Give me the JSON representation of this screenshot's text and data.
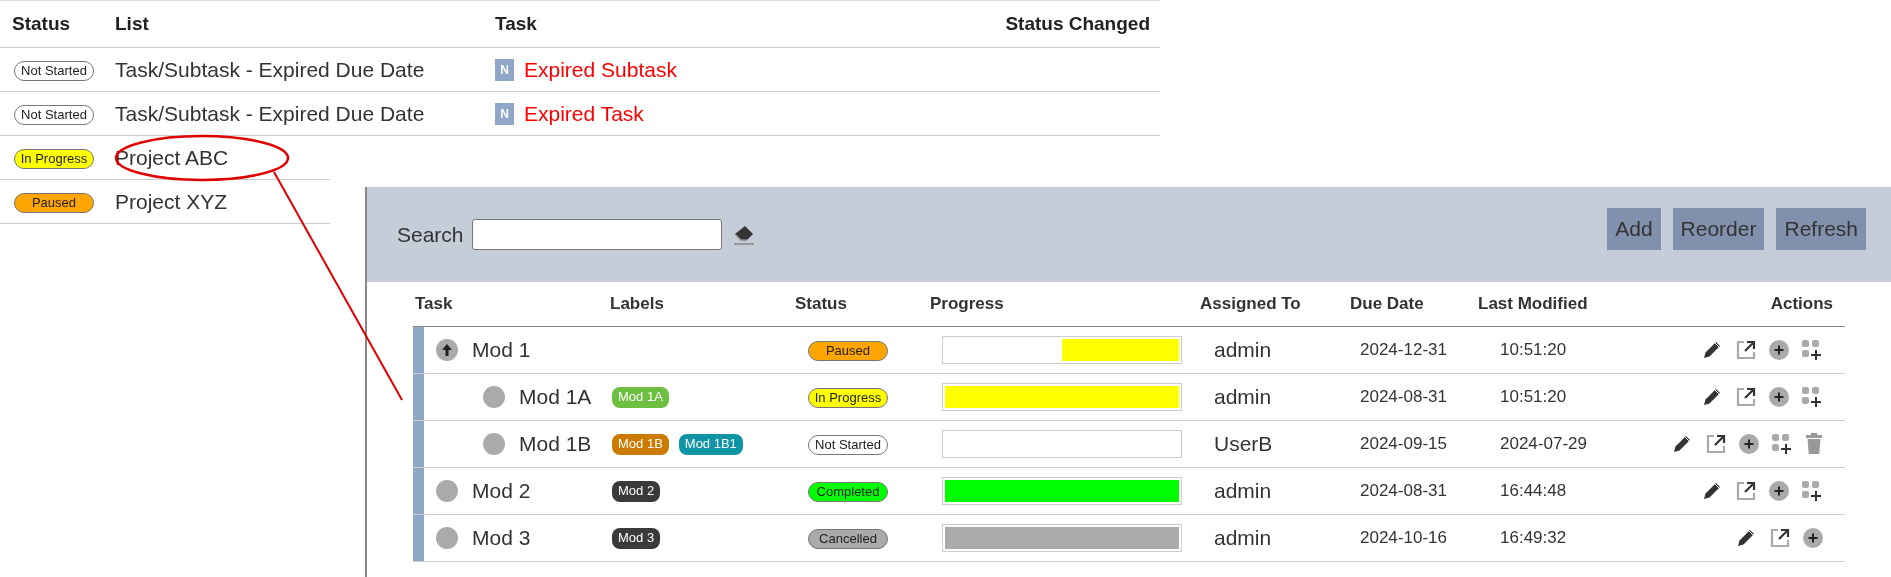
{
  "background_table": {
    "columns": [
      "Status",
      "List",
      "Task",
      "Status Changed"
    ],
    "rows": [
      {
        "status": {
          "text": "Not Started",
          "color": "#ffffff"
        },
        "list": "Task/Subtask - Expired Due Date",
        "task_badge": "N",
        "task": "Expired Subtask",
        "task_expired": true
      },
      {
        "status": {
          "text": "Not Started",
          "color": "#ffffff"
        },
        "list": "Task/Subtask - Expired Due Date",
        "task_badge": "N",
        "task": "Expired Task",
        "task_expired": true
      },
      {
        "status": {
          "text": "In Progress",
          "color": "#ffff00"
        },
        "list": "Project ABC"
      },
      {
        "status": {
          "text": "Paused",
          "color": "#ffa500"
        },
        "list": "Project XYZ"
      }
    ]
  },
  "panel": {
    "search": {
      "label": "Search"
    },
    "buttons": [
      "Add",
      "Reorder",
      "Refresh"
    ],
    "table": {
      "columns": [
        "Task",
        "Labels",
        "Status",
        "Progress",
        "Assigned To",
        "Due Date",
        "Last Modified",
        "Actions"
      ],
      "rows": [
        {
          "task": "Mod 1",
          "kind": "parent",
          "labels": [],
          "status": {
            "text": "Paused",
            "color": "#ffa500"
          },
          "progress": {
            "level": 0.5,
            "color": "#ffff00"
          },
          "assigned_to": "admin",
          "due_date": "2024-12-31",
          "last_modified": "10:51:20",
          "can_add_subtask": true,
          "can_delete": false,
          "children": [
            {
              "task": "Mod 1A",
              "kind": "leaf",
              "labels": [
                {
                  "text": "Mod 1A",
                  "color": "#6cbf3f"
                }
              ],
              "status": {
                "text": "In Progress",
                "color": "#ffff00"
              },
              "progress": {
                "level": 1,
                "color": "#ffff00"
              },
              "assigned_to": "admin",
              "due_date": "2024-08-31",
              "last_modified": "10:51:20",
              "can_add_subtask": true,
              "can_delete": false
            },
            {
              "task": "Mod 1B",
              "kind": "leaf",
              "labels": [
                {
                  "text": "Mod 1B",
                  "color": "#cc7a00"
                },
                {
                  "text": "Mod 1B1",
                  "color": "#0f94a6"
                }
              ],
              "status": {
                "text": "Not Started",
                "color": "#ffffff"
              },
              "progress": {
                "level": 0,
                "color": "#ffffff"
              },
              "assigned_to": "UserB",
              "due_date": "2024-09-15",
              "last_modified": "2024-07-29",
              "can_add_subtask": true,
              "can_delete": true
            }
          ]
        },
        {
          "task": "Mod 2",
          "kind": "leaf",
          "labels": [
            {
              "text": "Mod 2",
              "color": "#3a3a3a"
            }
          ],
          "status": {
            "text": "Completed",
            "color": "#00ff00"
          },
          "progress": {
            "level": 1,
            "color": "#00ff00"
          },
          "assigned_to": "admin",
          "due_date": "2024-08-31",
          "last_modified": "16:44:48",
          "can_add_subtask": true,
          "can_delete": false
        },
        {
          "task": "Mod 3",
          "kind": "leaf",
          "labels": [
            {
              "text": "Mod 3",
              "color": "#3a3a3a"
            }
          ],
          "status": {
            "text": "Cancelled",
            "color": "#aaaaaa"
          },
          "progress": {
            "level": 1,
            "color": "#aaaaaa"
          },
          "assigned_to": "admin",
          "due_date": "2024-10-16",
          "last_modified": "16:49:32",
          "can_add_subtask": false,
          "can_delete": false
        }
      ]
    }
  }
}
